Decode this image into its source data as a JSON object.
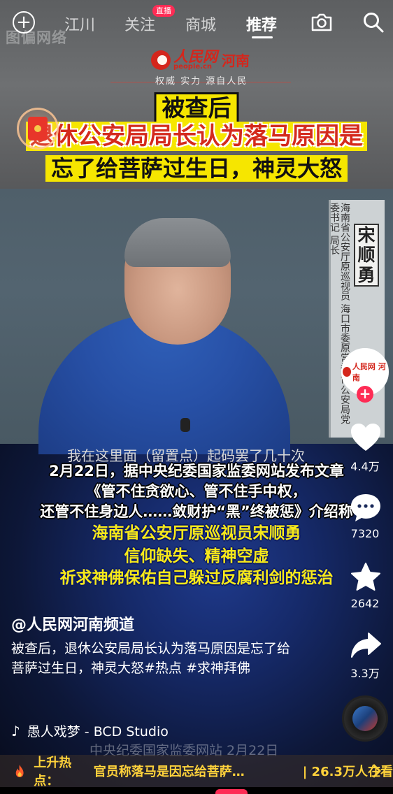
{
  "colors": {
    "accent_red": "#fe2c55",
    "headline_yellow": "#f6e600",
    "hot_yellow": "#ffd23b",
    "brand_red": "#d4261c"
  },
  "nav": {
    "tabs": [
      {
        "label": "江川"
      },
      {
        "label": "关注"
      },
      {
        "label": "商城"
      },
      {
        "label": "推荐"
      }
    ],
    "active_tab": "推荐",
    "live_badge": "直播",
    "icons": [
      "plus-circle-icon",
      "camera-icon",
      "search-icon"
    ]
  },
  "video": {
    "watermark_top": "图偏网络",
    "logo": {
      "name": "人民网",
      "site": "people.cn",
      "region": "河南",
      "slogan": "权威 实力 源自人民"
    },
    "headline": [
      "被查后",
      "退休公安局局长认为落马原因是",
      "忘了给菩萨过生日，神灵大怒"
    ],
    "nameplate": {
      "name": [
        "宋",
        "顺",
        "勇"
      ],
      "title": "海南省公安厅原巡视员 海口市委原常委 市公安局党委书记 局长"
    },
    "subtitle": "我在这里面（留置点）起码罢了几十次",
    "overlay_white": [
      "2月22日，据中央纪委国家监委网站发布文章",
      "《管不住贪欲心、管不住手中权，",
      "还管不住身边人……敛财护“黑”终被惩》介绍称"
    ],
    "overlay_yellow": [
      "海南省公安厅原巡视员宋顺勇",
      "信仰缺失、精神空虚",
      "祈求神佛保佑自己躲过反腐利剑的惩治"
    ],
    "watermark_bottom": "中央纪委国家监委网站 2月22日"
  },
  "actions": {
    "avatar_label": "人民网 河南",
    "follow": "+",
    "like_count": "4.4万",
    "comment_count": "7320",
    "favorite_count": "2642",
    "share_count": "3.3万"
  },
  "post": {
    "author": "@人民网河南频道",
    "caption": "被查后，退休公安局局长认为落马原因是忘了给菩萨过生日，神灵大怒#热点 #求神拜佛",
    "music": "愚人戏梦 - BCD Studio"
  },
  "hotbar": {
    "label": "上升热点：",
    "text": "官员称落马是因忘给菩萨…",
    "count": "| 26.3万人在看"
  }
}
